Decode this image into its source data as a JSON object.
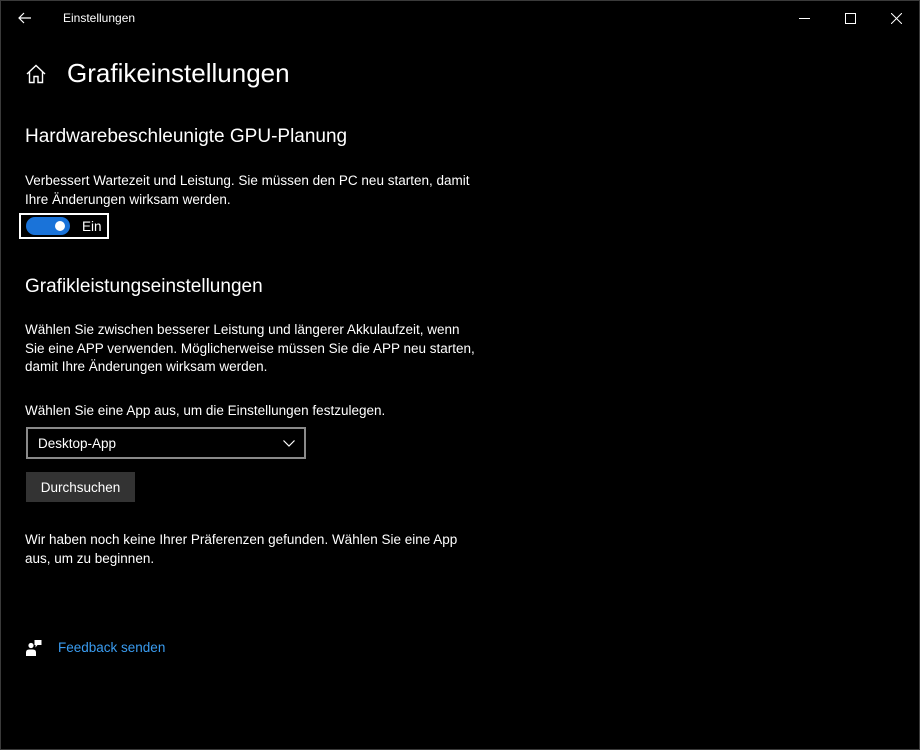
{
  "window": {
    "title": "Einstellungen"
  },
  "page": {
    "title": "Grafikeinstellungen"
  },
  "gpu_scheduling": {
    "heading": "Hardwarebeschleunigte GPU-Planung",
    "description": "Verbessert Wartezeit und Leistung. Sie müssen den PC neu starten, damit Ihre Änderungen wirksam werden.",
    "toggle_state": "Ein",
    "toggle_on": true
  },
  "graphics_performance": {
    "heading": "Grafikleistungseinstellungen",
    "description": "Wählen Sie zwischen besserer Leistung und längerer Akkulaufzeit, wenn Sie eine APP verwenden. Möglicherweise müssen Sie die APP neu starten, damit Ihre Änderungen wirksam werden.",
    "select_prompt": "Wählen Sie eine App aus, um die Einstellungen festzulegen.",
    "app_type_selected": "Desktop-App",
    "browse_label": "Durchsuchen",
    "empty_message": "Wir haben noch keine Ihrer Präferenzen gefunden. Wählen Sie eine App aus, um zu beginnen."
  },
  "feedback": {
    "label": "Feedback senden"
  },
  "colors": {
    "accent": "#1a73d9",
    "link": "#3a9cf0",
    "background": "#000000"
  },
  "icons": {
    "back": "arrow-left-icon",
    "minimize": "minimize-icon",
    "maximize": "maximize-icon",
    "close": "close-icon",
    "home": "home-icon",
    "chevron": "chevron-down-icon",
    "feedback": "feedback-icon"
  }
}
